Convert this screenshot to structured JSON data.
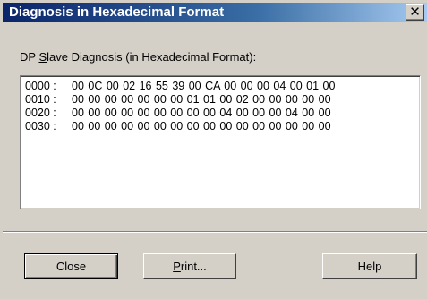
{
  "window": {
    "title": "Diagnosis in Hexadecimal Format",
    "close_glyph": "✕"
  },
  "section": {
    "label_prefix": "DP ",
    "label_mnemonic": "S",
    "label_rest": "lave Diagnosis (in Hexadecimal Format):"
  },
  "hex_rows": [
    {
      "address": "0000 :",
      "bytes": "00 0C 00 02 16 55 39 00 CA 00 00 00 04 00 01 00"
    },
    {
      "address": "0010 :",
      "bytes": "00 00 00 00 00 00 00 01 01 00 02 00 00 00 00 00"
    },
    {
      "address": "0020 :",
      "bytes": "00 00 00 00 00 00 00 00 00 04 00 00 00 04 00 00"
    },
    {
      "address": "0030 :",
      "bytes": "00 00 00 00 00 00 00 00 00 00 00 00 00 00 00 00"
    }
  ],
  "buttons": {
    "close_label": "Close",
    "print_mnemonic": "P",
    "print_rest": "rint...",
    "help_label": "Help"
  },
  "colors": {
    "title_bar_start": "#0a246a",
    "title_bar_end": "#a6caf0",
    "dialog_face": "#d4d0c8"
  }
}
